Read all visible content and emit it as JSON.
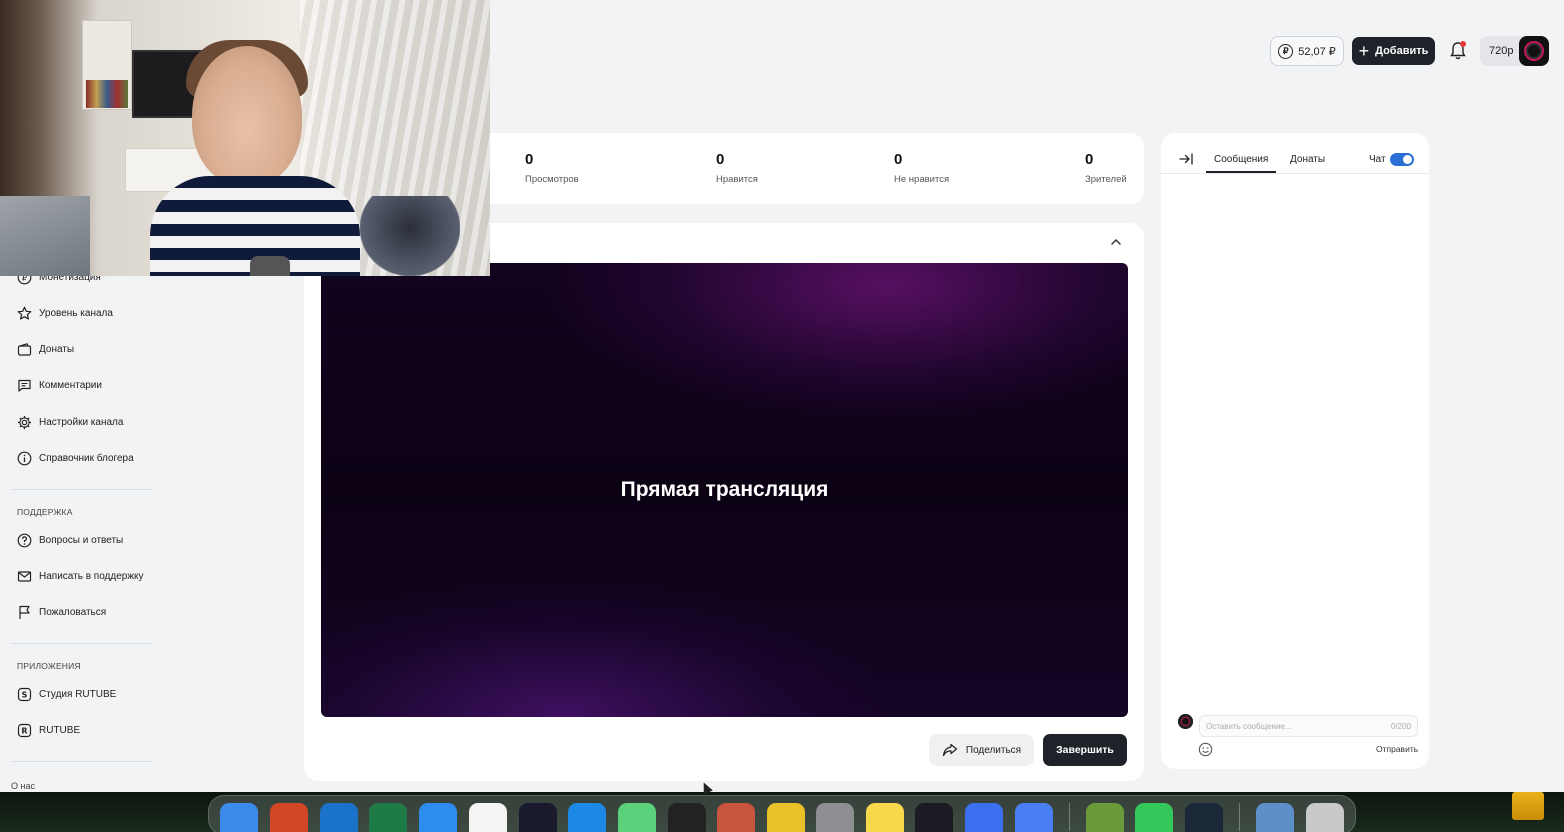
{
  "header": {
    "balance": "52,07 ₽",
    "add_label": "Добавить",
    "quality": "720p"
  },
  "sidebar": {
    "items_top": [
      {
        "label": "Монетизация",
        "icon": "ruble-circle-icon"
      },
      {
        "label": "Уровень канала",
        "icon": "star-icon"
      },
      {
        "label": "Донаты",
        "icon": "wallet-icon"
      },
      {
        "label": "Комментарии",
        "icon": "comment-icon"
      },
      {
        "label": "Настройки канала",
        "icon": "gear-icon"
      },
      {
        "label": "Справочник блогера",
        "icon": "info-icon"
      }
    ],
    "support_label": "ПОДДЕРЖКА",
    "support_items": [
      {
        "label": "Вопросы и ответы",
        "icon": "question-icon"
      },
      {
        "label": "Написать в поддержку",
        "icon": "mail-icon"
      },
      {
        "label": "Пожаловаться",
        "icon": "flag-icon"
      }
    ],
    "apps_label": "ПРИЛОЖЕНИЯ",
    "apps_items": [
      {
        "label": "Студия RUTUBE",
        "icon": "studio-icon"
      },
      {
        "label": "RUTUBE",
        "icon": "rutube-icon"
      }
    ],
    "about": "О нас"
  },
  "stats": [
    {
      "value": "0",
      "label": "Просмотров"
    },
    {
      "value": "0",
      "label": "Нравится"
    },
    {
      "value": "0",
      "label": "Не нравится"
    },
    {
      "value": "0",
      "label": "Зрителей"
    }
  ],
  "player": {
    "title": "Прямая трансляция"
  },
  "actions": {
    "share_label": "Поделиться",
    "finish_label": "Завершить"
  },
  "chat": {
    "tabs": [
      "Сообщения",
      "Донаты"
    ],
    "toggle_label": "Чат",
    "toggle_on": true,
    "input_placeholder": "Оставить сообщение...",
    "counter": "0/200",
    "send_label": "Отправить"
  },
  "colors": {
    "accent": "#2b6fd6",
    "dark_button": "#1f2329",
    "notification_dot": "#e53935"
  },
  "dock": {
    "apps": [
      "finder-icon",
      "powerpoint-icon",
      "outlook-icon",
      "excel-icon",
      "safari-icon",
      "calendar-icon",
      "rutube-app-icon",
      "app-store-icon",
      "chat-app-icon",
      "roblox-studio-icon",
      "game-icon",
      "geometry-dash-icon",
      "system-settings-icon",
      "notes-icon",
      "obs-icon",
      "roblox-icon",
      "roblox-player-icon",
      "minecraft-icon",
      "phone-icon",
      "steam-icon",
      "downloads-folder-icon",
      "trash-icon"
    ]
  }
}
